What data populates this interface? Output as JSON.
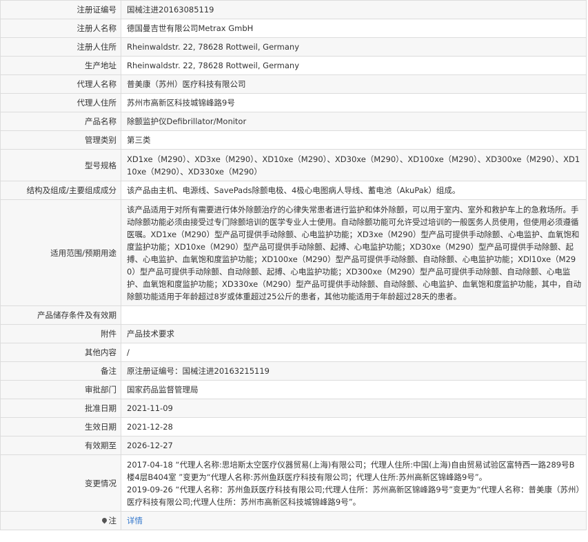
{
  "rows": [
    {
      "label": "注册证编号",
      "value": "国械注进20163085119"
    },
    {
      "label": "注册人名称",
      "value": "德国曼吉世有限公司Metrax GmbH"
    },
    {
      "label": "注册人住所",
      "value": "Rheinwaldstr. 22, 78628 Rottweil, Germany"
    },
    {
      "label": "生产地址",
      "value": "Rheinwaldstr. 22, 78628 Rottweil, Germany"
    },
    {
      "label": "代理人名称",
      "value": "普美康（苏州）医疗科技有限公司"
    },
    {
      "label": "代理人住所",
      "value": "苏州市高新区科技城锦峰路9号"
    },
    {
      "label": "产品名称",
      "value": "除颤监护仪Defibrillator/Monitor"
    },
    {
      "label": "管理类别",
      "value": "第三类"
    },
    {
      "label": "型号规格",
      "value": "XD1xe（M290）、XD3xe（M290）、XD10xe（M290）、XD30xe（M290）、XD100xe（M290）、XD300xe（M290）、XD110xe（M290）、XD330xe（M290）"
    },
    {
      "label": "结构及组成/主要组成成分",
      "value": "该产品由主机、电源线、SavePads除颤电极、4极心电图病人导线、蓄电池（AkuPak）组成。"
    },
    {
      "label": "适用范围/预期用途",
      "value": "该产品适用于对所有需要进行体外除颤治疗的心律失常患者进行监护和体外除颤，可以用于室内、室外和救护车上的急救场所。手动除颤功能必须由接受过专门除颤培训的医学专业人士使用。自动除颤功能可允许受过培训的一般医务人员使用，但使用必须遵循医嘱。XD1xe（M290）型产品可提供手动除颤、心电监护功能；XD3xe（M290）型产品可提供手动除颤、心电监护、血氧饱和度监护功能；XD10xe（M290）型产品可提供手动除颤、起搏、心电监护功能；XD30xe（M290）型产品可提供手动除颤、起搏、心电监护、血氧饱和度监护功能；XD100xe（M290）型产品可提供手动除颤、自动除颤、心电监护功能；XDl10xe（M290）型产品可提供手动除颤、自动除颤、起搏、心电监护功能；XD300xe（M290）型产品可提供手动除颤、自动除颤、心电监护、血氧饱和度监护功能；XD330xe（M290）型产品可提供手动除颤、自动除颤、心电监护、血氧饱和度监护功能，其中，自动除颤功能适用于年龄超过8岁或体重超过25公斤的患者，其他功能适用于年龄超过28天的患者。"
    },
    {
      "label": "产品储存条件及有效期",
      "value": ""
    },
    {
      "label": "附件",
      "value": "产品技术要求"
    },
    {
      "label": "其他内容",
      "value": "/"
    },
    {
      "label": "备注",
      "value": "原注册证编号：国械注进20163215119"
    },
    {
      "label": "审批部门",
      "value": "国家药品监督管理局"
    },
    {
      "label": "批准日期",
      "value": "2021-11-09"
    },
    {
      "label": "生效日期",
      "value": "2021-12-28"
    },
    {
      "label": "有效期至",
      "value": "2026-12-27"
    }
  ],
  "changes": {
    "label": "变更情况",
    "entries": [
      "2017-04-18 “代理人名称:思培斯太空医疗仪器贸易(上海)有限公司；代理人住所:中国(上海)自由贸易试验区富特西一路289号B楼4层B404室 ”变更为“代理人名称:苏州鱼跃医疗科技有限公司；代理人住所:苏州高新区锦峰路9号”。",
      "2019-09-26 “代理人名称：苏州鱼跃医疗科技有限公司;代理人住所：苏州高新区锦峰路9号”变更为“代理人名称：普美康（苏州）医疗科技有限公司;代理人住所：苏州市高新区科技城锦峰路9号”。"
    ]
  },
  "note": {
    "label": "注",
    "icon": "location-pin-icon",
    "link_text": "详情",
    "link_color": "#3377cc"
  }
}
